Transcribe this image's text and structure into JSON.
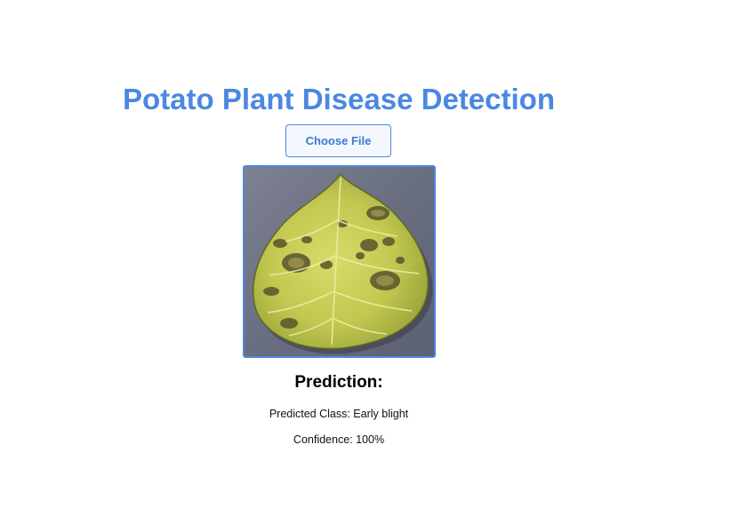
{
  "header": {
    "title": "Potato Plant Disease Detection"
  },
  "upload": {
    "choose_label": "Choose File"
  },
  "preview": {
    "image_name": "potato-leaf-image"
  },
  "prediction": {
    "heading": "Prediction:",
    "class_line": "Predicted Class: Early blight",
    "confidence_line": "Confidence: 100%"
  },
  "colors": {
    "accent": "#4a88e2",
    "text": "#000000",
    "background": "#ffffff"
  }
}
